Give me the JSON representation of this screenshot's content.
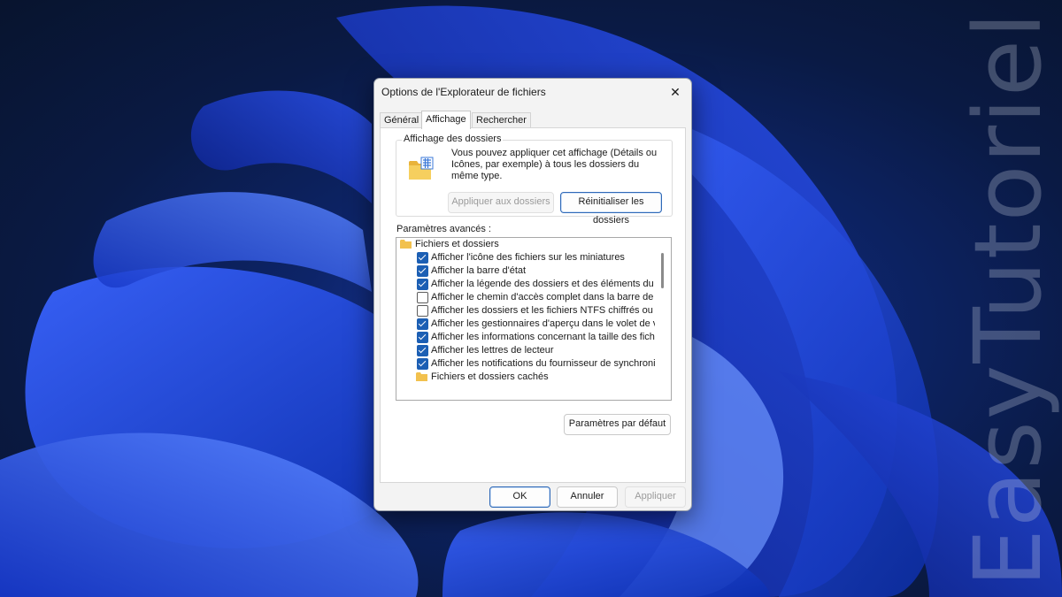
{
  "dialog": {
    "title": "Options de l'Explorateur de fichiers",
    "close_glyph": "✕",
    "tabs": [
      {
        "label": "Général",
        "active": false
      },
      {
        "label": "Affichage",
        "active": true
      },
      {
        "label": "Rechercher",
        "active": false
      }
    ],
    "folder_view": {
      "legend": "Affichage des dossiers",
      "description": "Vous pouvez appliquer cet affichage (Détails ou Icônes, par exemple) à tous les dossiers du même type.",
      "apply_button": "Appliquer aux dossiers",
      "reset_button": "Réinitialiser les dossiers"
    },
    "advanced_label": "Paramètres avancés :",
    "tree": {
      "root": {
        "label": "Fichiers et dossiers",
        "icon": "folder-icon"
      },
      "items": [
        {
          "label": "Afficher l'icône des fichiers sur les miniatures",
          "checked": true
        },
        {
          "label": "Afficher la barre d'état",
          "checked": true
        },
        {
          "label": "Afficher la légende des dossiers et des éléments du Burea",
          "checked": true
        },
        {
          "label": "Afficher le chemin d'accès complet dans la barre de titre",
          "checked": false
        },
        {
          "label": "Afficher les dossiers et les fichiers NTFS chiffrés ou comp",
          "checked": false
        },
        {
          "label": "Afficher les gestionnaires d'aperçu dans le volet de visual",
          "checked": true
        },
        {
          "label": "Afficher les informations concernant la taille des fichiers d",
          "checked": true
        },
        {
          "label": "Afficher les lettres de lecteur",
          "checked": true
        },
        {
          "label": "Afficher les notifications du fournisseur de synchronisation",
          "checked": true
        }
      ],
      "subfolder": {
        "label": "Fichiers et dossiers cachés",
        "icon": "folder-icon"
      }
    },
    "defaults_button": "Paramètres par défaut",
    "footer": {
      "ok": "OK",
      "cancel": "Annuler",
      "apply": "Appliquer"
    }
  },
  "watermark": "EasyTutoriel",
  "colors": {
    "accent": "#1c5fb4",
    "folder": "#f2c14e",
    "wallpaper_blue": "#1f3fb8"
  }
}
